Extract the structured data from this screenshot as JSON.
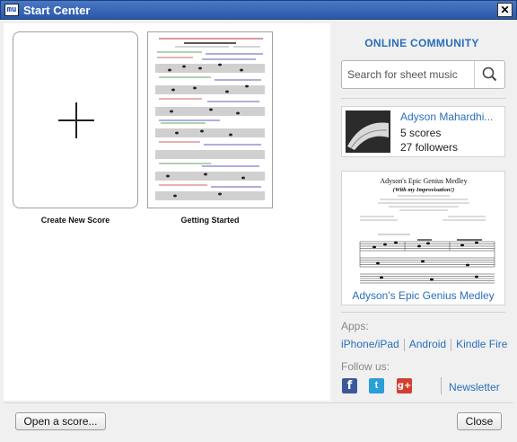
{
  "window": {
    "title": "Start Center",
    "app_icon_glyph": "mu",
    "close_glyph": "✕"
  },
  "scores": {
    "new_score": {
      "label": "Create New Score"
    },
    "getting_started": {
      "label": "Getting Started"
    }
  },
  "community": {
    "heading": "ONLINE COMMUNITY",
    "search_placeholder": "Search for sheet music",
    "featured_user": {
      "name": "Adyson Mahardhi...",
      "scores": "5 scores",
      "followers": "27 followers"
    },
    "featured_score": {
      "title": "Adyson's Epic Genius Medley",
      "sheet_title": "Adyson's Epic Genius Medley",
      "sheet_subtitle": "(With my Improvisation!)"
    },
    "apps_label": "Apps:",
    "apps": [
      "iPhone/iPad",
      "Android",
      "Kindle Fire"
    ],
    "follow_label": "Follow us:",
    "newsletter": "Newsletter"
  },
  "footer": {
    "open_button": "Open a score...",
    "close_button": "Close"
  },
  "colors": {
    "accent": "#2a6ebb",
    "titlebar": "#2a57a8",
    "facebook": "#3b5998",
    "twitter": "#2a9fd8",
    "google_plus": "#d23f31"
  }
}
